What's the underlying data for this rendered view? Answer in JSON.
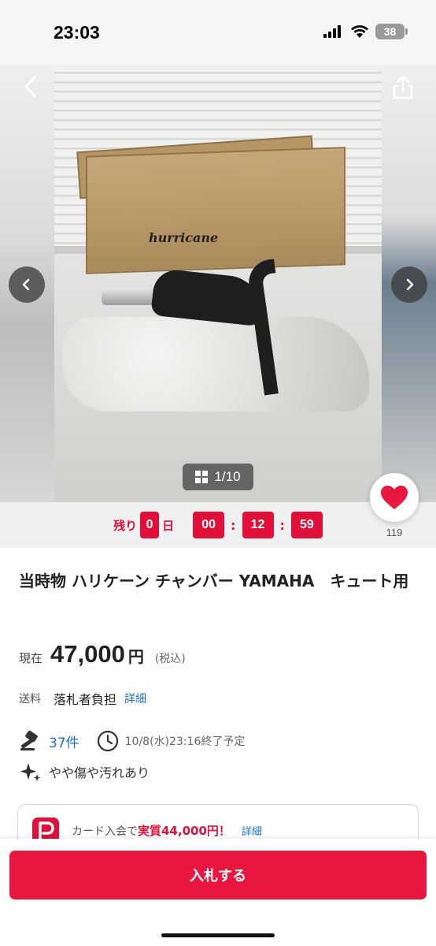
{
  "status_bar": {
    "time": "23:03",
    "battery": "38"
  },
  "gallery": {
    "counter": "1/10",
    "box_logo": "hurricane"
  },
  "countdown": {
    "prefix": "残り",
    "days": "0",
    "days_unit": "日",
    "hours": "00",
    "minutes": "12",
    "seconds": "59",
    "separator": ":"
  },
  "watch": {
    "count": "119"
  },
  "item": {
    "title": "当時物 ハリケーン チャンバー YAMAHA　キュート用",
    "price_label": "現在",
    "price": "47,000",
    "price_unit": "円",
    "tax_note": "(税込)",
    "shipping_label": "送料",
    "shipping_value": "落札者負担",
    "shipping_detail": "詳細",
    "bids": "37件",
    "end_time": "10/8(水)23:16終了予定",
    "condition": "やや傷や汚れあり"
  },
  "promo": {
    "prefix": "カード入会で",
    "highlight": "実質44,000円！",
    "link": "詳細"
  },
  "actions": {
    "bid_button": "入札する"
  },
  "colors": {
    "accent": "#e8173f",
    "link": "#1a6fd6",
    "countdown": "#e0103a"
  }
}
